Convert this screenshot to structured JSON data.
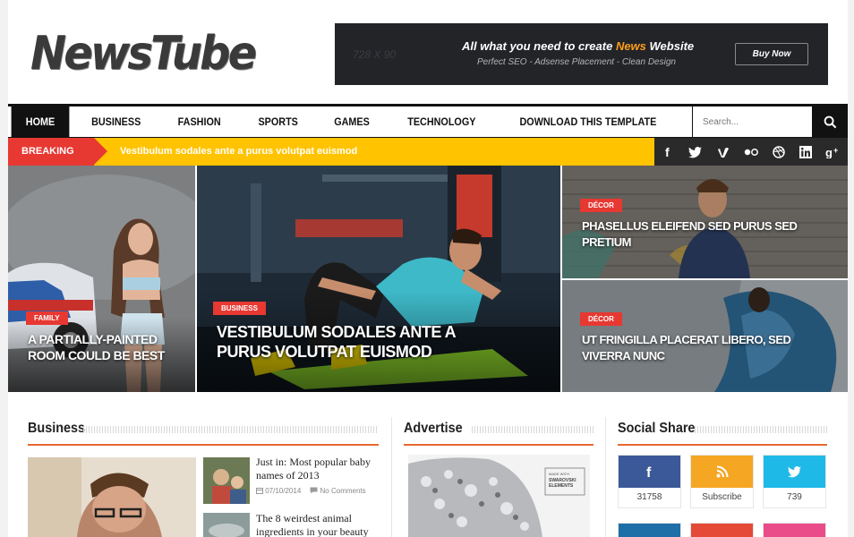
{
  "logo": {
    "text": "NewsTube"
  },
  "ad": {
    "dimension": "728 X 90",
    "headline_pre": "All what you need to create ",
    "headline_accent": "News",
    "headline_post": " Website",
    "subtitle": "Perfect SEO - Adsense Placement - Clean Design",
    "button": "Buy Now"
  },
  "nav": {
    "items": [
      "HOME",
      "BUSINESS",
      "FASHION",
      "SPORTS",
      "GAMES",
      "TECHNOLOGY",
      "DOWNLOAD THIS TEMPLATE"
    ],
    "search_placeholder": "Search..."
  },
  "breaking": {
    "label": "BREAKING",
    "text": "Vestibulum sodales ante a purus volutpat euismod"
  },
  "social_icons": [
    "facebook-icon",
    "twitter-icon",
    "vimeo-icon",
    "flickr-icon",
    "dribbble-icon",
    "linkedin-icon",
    "googleplus-icon"
  ],
  "featured": [
    {
      "category": "FAMILY",
      "title": "A PARTIALLY-PAINTED ROOM COULD BE BEST"
    },
    {
      "category": "BUSINESS",
      "title": "VESTIBULUM SODALES ANTE A PURUS VOLUTPAT EUISMOD"
    },
    {
      "category": "DÉCOR",
      "title": "PHASELLUS ELEIFEND SED PURUS SED PRETIUM"
    },
    {
      "category": "DÉCOR",
      "title": "UT FRINGILLA PLACERAT LIBERO, SED VIVERRA NUNC"
    }
  ],
  "sections": {
    "business": "Business",
    "advertise": "Advertise",
    "social": "Social Share"
  },
  "business_posts": [
    {
      "title": "Just in: Most popular baby names of 2013",
      "date": "07/10/2014",
      "comments": "No Comments"
    },
    {
      "title": "The 8 weirdest animal ingredients in your beauty",
      "date": "",
      "comments": ""
    }
  ],
  "advert": {
    "brand": "SWAROVSKI ELEMENTS",
    "tag": "MADE WITH"
  },
  "social_share": [
    {
      "icon": "facebook-icon",
      "label": "31758",
      "color": "#3b5998"
    },
    {
      "icon": "rss-icon",
      "label": "Subscribe",
      "color": "#f5a623"
    },
    {
      "icon": "twitter-icon",
      "label": "739",
      "color": "#1fb9e8"
    }
  ],
  "colors": {
    "accent": "#e73832",
    "breaking_bg": "#ffc300",
    "section_rule": "#e8692f",
    "nav_dark": "#111111"
  }
}
